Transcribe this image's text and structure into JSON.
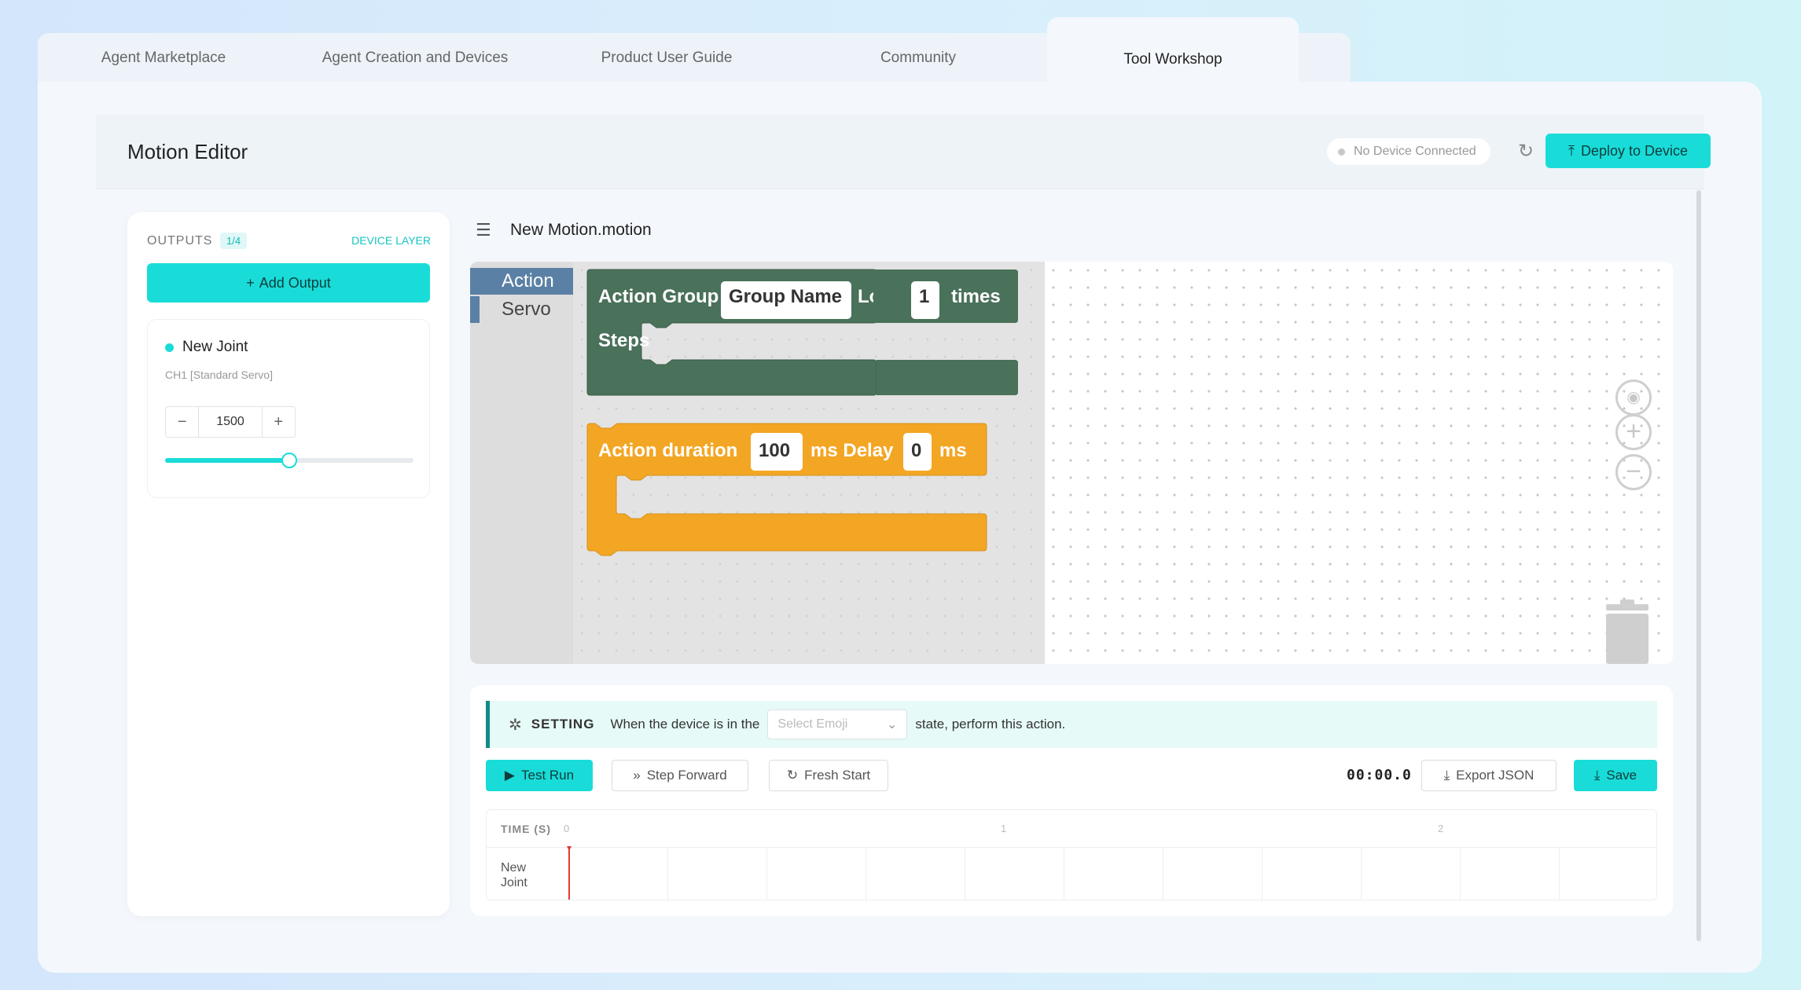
{
  "tabs": [
    {
      "label": "Agent Marketplace"
    },
    {
      "label": "Agent Creation and Devices"
    },
    {
      "label": "Product User Guide"
    },
    {
      "label": "Community"
    },
    {
      "label": "Tool Workshop",
      "active": true
    }
  ],
  "header": {
    "title": "Motion Editor",
    "status": "No Device Connected",
    "deploy_label": "Deploy to Device"
  },
  "sidebar": {
    "outputs_label": "OUTPUTS",
    "outputs_count": "1/4",
    "device_layer_label": "DEVICE LAYER",
    "add_output_label": "Add Output",
    "joint": {
      "name": "New Joint",
      "channel": "CH1 [Standard Servo]",
      "value": "1500",
      "slider_fraction": 0.5
    }
  },
  "editor": {
    "file_name": "New Motion.motion",
    "categories": [
      {
        "label": "Action",
        "color": "#5b80a5",
        "selected": true
      },
      {
        "label": "Servo",
        "color": "#5b80a5"
      }
    ],
    "blocks": {
      "action_group": {
        "color": "#4a715a",
        "label": "Action Group",
        "group_name": "Group Name",
        "loop_label": "Loop",
        "loop_value": "1",
        "times_label": "times",
        "steps_label": "Steps"
      },
      "action_duration": {
        "color": "#f3a624",
        "label": "Action duration",
        "duration_value": "100",
        "delay_label": "ms Delay",
        "delay_value": "0",
        "ms_label": "ms"
      }
    }
  },
  "setting": {
    "label": "SETTING",
    "text_before": "When the device is in the",
    "emoji_placeholder": "Select Emoji",
    "text_after": "state, perform this action."
  },
  "controls": {
    "test_run": "Test Run",
    "step_forward": "Step Forward",
    "fresh_start": "Fresh Start",
    "timer": "00:00.0",
    "export_json": "Export JSON",
    "save": "Save"
  },
  "timeline": {
    "time_label": "TIME (S)",
    "ticks": [
      "0",
      "1",
      "2"
    ],
    "row_name": "New Joint"
  },
  "colors": {
    "accent": "#19dcd8",
    "playhead": "#e53935"
  }
}
